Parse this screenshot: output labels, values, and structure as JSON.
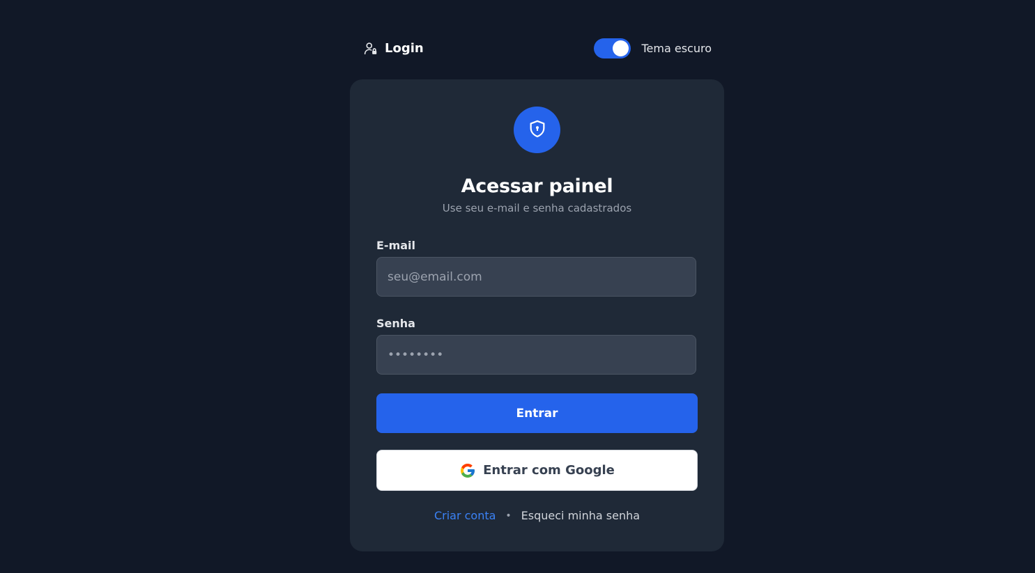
{
  "header": {
    "brand_icon": "user-lock-icon",
    "brand_label": "Login",
    "theme_toggle_label": "Tema escuro",
    "theme_toggle_on": true
  },
  "card": {
    "badge_icon": "shield-keyhole-icon",
    "title": "Acessar painel",
    "subtitle": "Use seu e-mail e senha cadastrados",
    "email": {
      "label": "E-mail",
      "placeholder": "seu@email.com",
      "value": ""
    },
    "password": {
      "label": "Senha",
      "placeholder": "••••••••",
      "value": ""
    },
    "submit_label": "Entrar",
    "google": {
      "icon": "google-logo-icon",
      "label": "Entrar com Google"
    },
    "links": {
      "create_account": "Criar conta",
      "separator": "•",
      "forgot_password": "Esqueci minha senha"
    }
  },
  "colors": {
    "background": "#111827",
    "card": "#1f2937",
    "accent": "#2563eb",
    "input_bg": "#374151",
    "link": "#3b82f6"
  }
}
